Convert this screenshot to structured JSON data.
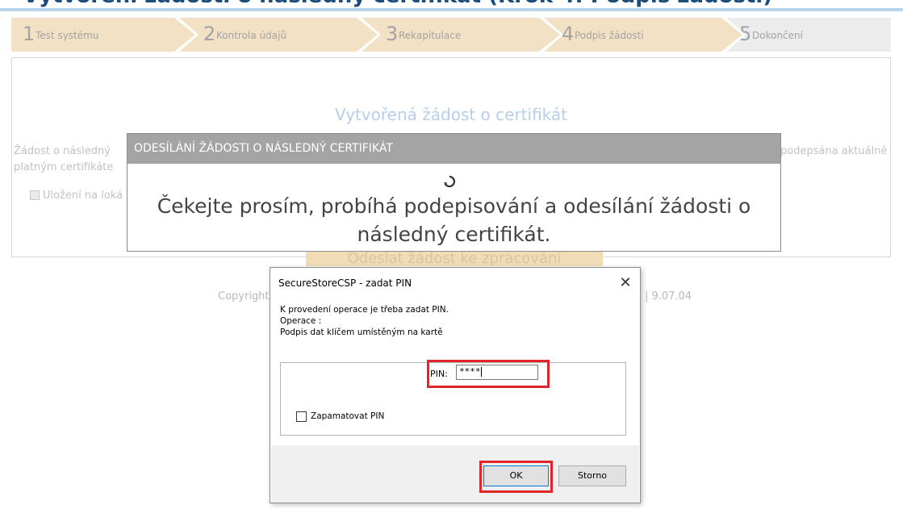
{
  "steps": [
    {
      "num": "1",
      "label": "Test systému"
    },
    {
      "num": "2",
      "label": "Kontrola údajů"
    },
    {
      "num": "3",
      "label": "Rekapitulace"
    },
    {
      "num": "4",
      "label": "Podpis žádosti"
    },
    {
      "num": "5",
      "label": "Dokončení"
    }
  ],
  "panel": {
    "title": "Vytvořená žádost o certifikát",
    "text_left_1": "Žádost o následný",
    "text_left_2": "platným certifikáte",
    "text_right": "podepsána aktuálně",
    "checkbox_label": "Uložení na loká",
    "send_button": "Odeslat žádost ke zpracování"
  },
  "footer": {
    "copyright_left": "Copyright",
    "copyright_right": "| 9.07.04"
  },
  "modal": {
    "title": "ODESÍLÁNÍ ŽÁDOSTI O NÁSLEDNÝ CERTIFIKÁT",
    "message_line1": "Čekejte prosím, probíhá podepisování a odesílání žádosti o",
    "message_line2": "následný certifikát."
  },
  "dialog": {
    "title": "SecureStoreCSP - zadat PIN",
    "close": "✕",
    "line1": "K provedení operace je třeba zadat PIN.",
    "line2": "Operace :",
    "line3": "Podpis dat klíčem umístěným na kartě",
    "pin_label": "PIN:",
    "pin_value": "****",
    "remember_label": "Zapamatovat PIN",
    "ok": "OK",
    "cancel": "Storno"
  },
  "colors": {
    "step_active": "#f2e1c4",
    "step_inactive": "#ececec",
    "highlight": "#e0262b"
  }
}
